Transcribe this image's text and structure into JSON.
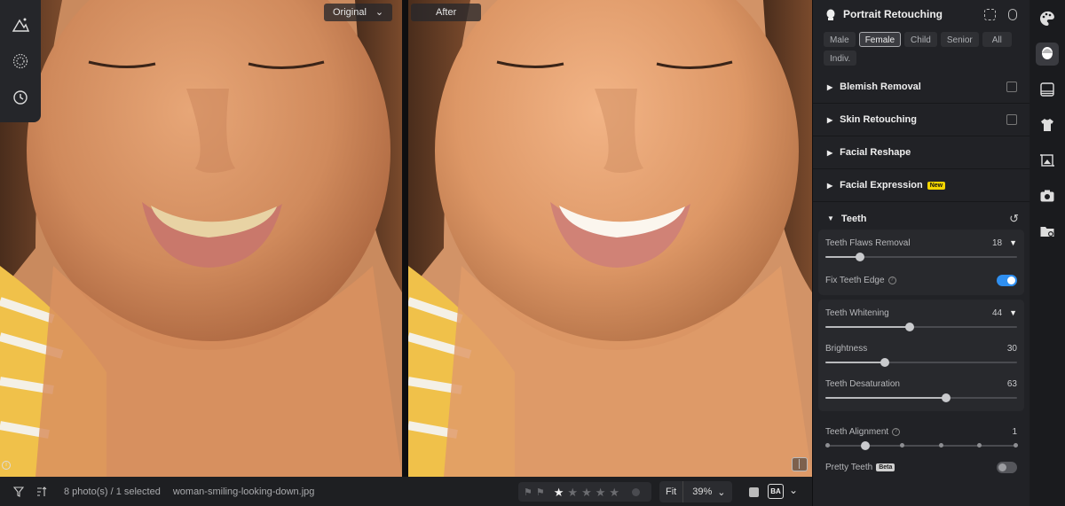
{
  "viewer": {
    "original_label": "Original",
    "after_label": "After"
  },
  "bottom_bar": {
    "photo_count": "8 photo(s) / 1 selected",
    "filename": "woman-smiling-looking-down.jpg",
    "rating": 1,
    "max_rating": 5,
    "zoom_fit": "Fit",
    "zoom_value": "39%",
    "before_after_label": "BA"
  },
  "panel": {
    "title": "Portrait Retouching",
    "chips": [
      "Male",
      "Female",
      "Child",
      "Senior",
      "All",
      "Indiv."
    ],
    "active_chip": "Female",
    "sections": {
      "blemish": "Blemish Removal",
      "skin": "Skin Retouching",
      "reshape": "Facial Reshape",
      "expression": "Facial Expression",
      "expression_badge": "New",
      "teeth": "Teeth"
    },
    "teeth": {
      "flaws_label": "Teeth Flaws Removal",
      "flaws_value": "18",
      "fix_edge_label": "Fix Teeth Edge",
      "fix_edge_on": true,
      "whitening_label": "Teeth Whitening",
      "whitening_value": "44",
      "brightness_label": "Brightness",
      "brightness_value": "30",
      "desaturation_label": "Teeth Desaturation",
      "desaturation_value": "63",
      "alignment_label": "Teeth Alignment",
      "alignment_value": "1",
      "pretty_label": "Pretty Teeth",
      "pretty_badge": "Beta",
      "pretty_on": false
    }
  },
  "rail_icons": [
    "palette-icon",
    "portrait-icon",
    "landscape-icon",
    "tshirt-icon",
    "crop-icon",
    "camera-icon",
    "folder-icon"
  ],
  "colors": {
    "accent": "#2f8ff0",
    "new_badge": "#f3d500",
    "panel_bg": "#212226"
  }
}
